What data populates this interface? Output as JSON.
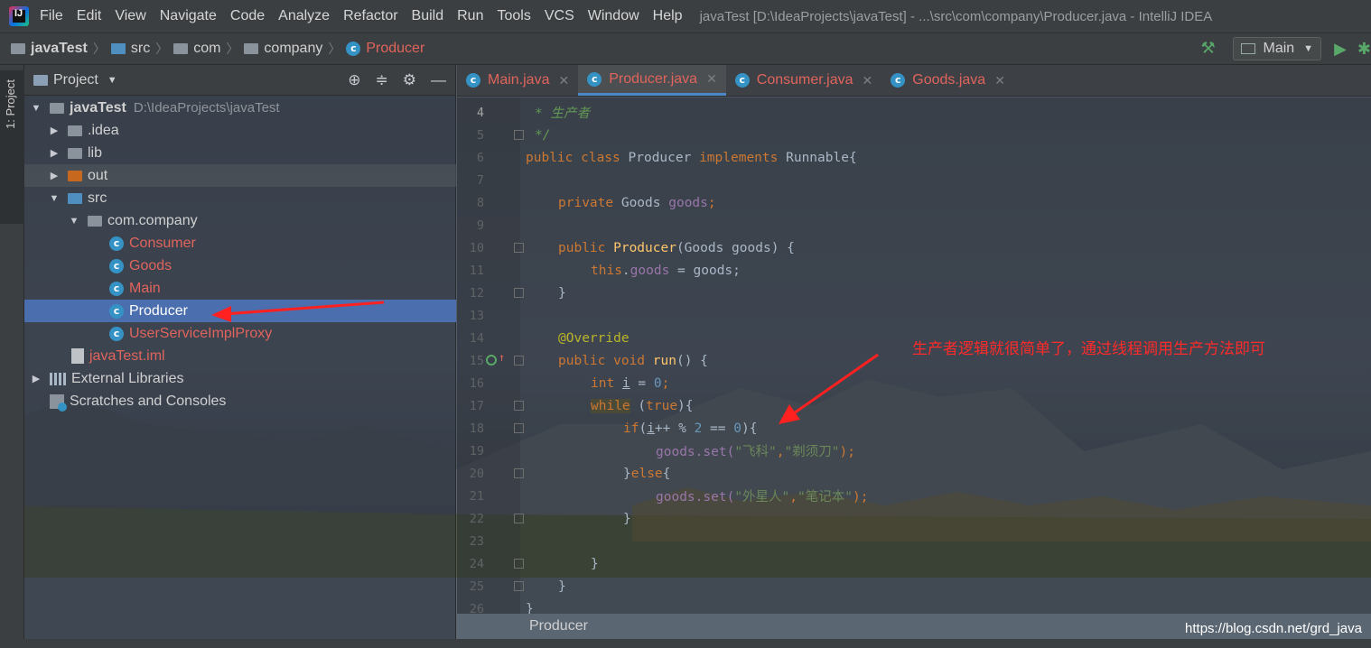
{
  "menu": {
    "items": [
      "File",
      "Edit",
      "View",
      "Navigate",
      "Code",
      "Analyze",
      "Refactor",
      "Build",
      "Run",
      "Tools",
      "VCS",
      "Window",
      "Help"
    ],
    "window_title": "javaTest [D:\\IdeaProjects\\javaTest] - ...\\src\\com\\company\\Producer.java - IntelliJ IDEA"
  },
  "navbar": {
    "crumbs": [
      "javaTest",
      "src",
      "com",
      "company",
      "Producer"
    ],
    "run_config": "Main"
  },
  "left_strip": {
    "tab_label": "1: Project"
  },
  "project_panel": {
    "title": "Project",
    "root": {
      "name": "javaTest",
      "path": "D:\\IdeaProjects\\javaTest"
    },
    "nodes": {
      "idea": ".idea",
      "lib": "lib",
      "out": "out",
      "src": "src",
      "pkg": "com.company",
      "consumer": "Consumer",
      "goods": "Goods",
      "main": "Main",
      "producer": "Producer",
      "proxy": "UserServiceImplProxy",
      "iml": "javaTest.iml",
      "ext_libs": "External Libraries",
      "scratches": "Scratches and Consoles"
    }
  },
  "tabs": [
    {
      "label": "Main.java",
      "active": false
    },
    {
      "label": "Producer.java",
      "active": true
    },
    {
      "label": "Consumer.java",
      "active": false
    },
    {
      "label": "Goods.java",
      "active": false
    }
  ],
  "editor": {
    "line_numbers": [
      "4",
      "5",
      "6",
      "7",
      "8",
      "9",
      "10",
      "11",
      "12",
      "13",
      "14",
      "15",
      "16",
      "17",
      "18",
      "19",
      "20",
      "21",
      "22",
      "23",
      "24",
      "25",
      "26"
    ],
    "lines": {
      "l4": "* 生产者",
      "l5": "*/",
      "l6_kw": "public class ",
      "l6_name": "Producer ",
      "l6_kw2": "implements ",
      "l6_rest": "Runnable{",
      "l8_kw": "private ",
      "l8_type": "Goods ",
      "l8_field": "goods",
      "l8_end": ";",
      "l10_kw": "public ",
      "l10_name": "Producer",
      "l10_rest": "(Goods goods) {",
      "l11_kw": "this",
      "l11_dot": ".",
      "l11_field": "goods",
      "l11_rest": " = goods;",
      "l12": "}",
      "l14": "@Override",
      "l15_kw": "public void ",
      "l15_name": "run",
      "l15_rest": "() {",
      "l16_kw": "int ",
      "l16_var": "i",
      "l16_eq": " = ",
      "l16_num": "0",
      "l16_end": ";",
      "l17_kw": "while",
      "l17_sp": " (",
      "l17_true": "true",
      "l17_end": "){",
      "l18_kw": "if",
      "l18_a": "(",
      "l18_var": "i",
      "l18_b": "++ % ",
      "l18_n1": "2",
      "l18_c": " == ",
      "l18_n2": "0",
      "l18_d": "){",
      "l19_a": "goods.set(",
      "l19_s1": "\"飞科\"",
      "l19_comma": ",",
      "l19_s2": "\"剃须刀\"",
      "l19_end": ");",
      "l20_a": "}",
      "l20_kw": "else",
      "l20_b": "{",
      "l21_a": "goods.set(",
      "l21_s1": "\"外星人\"",
      "l21_comma": ",",
      "l21_s2": "\"笔记本\"",
      "l21_end": ");",
      "l22": "}",
      "l24": "}",
      "l25": "}",
      "l26": "}"
    },
    "breadcrumb": "Producer"
  },
  "annotation": "生产者逻辑就很简单了，通过线程调用生产方法即可",
  "watermark": "https://blog.csdn.net/grd_java",
  "colors": {
    "arrow": "#ff2020",
    "selection": "#4b6eaf",
    "accent_tab": "#4a88c7"
  }
}
